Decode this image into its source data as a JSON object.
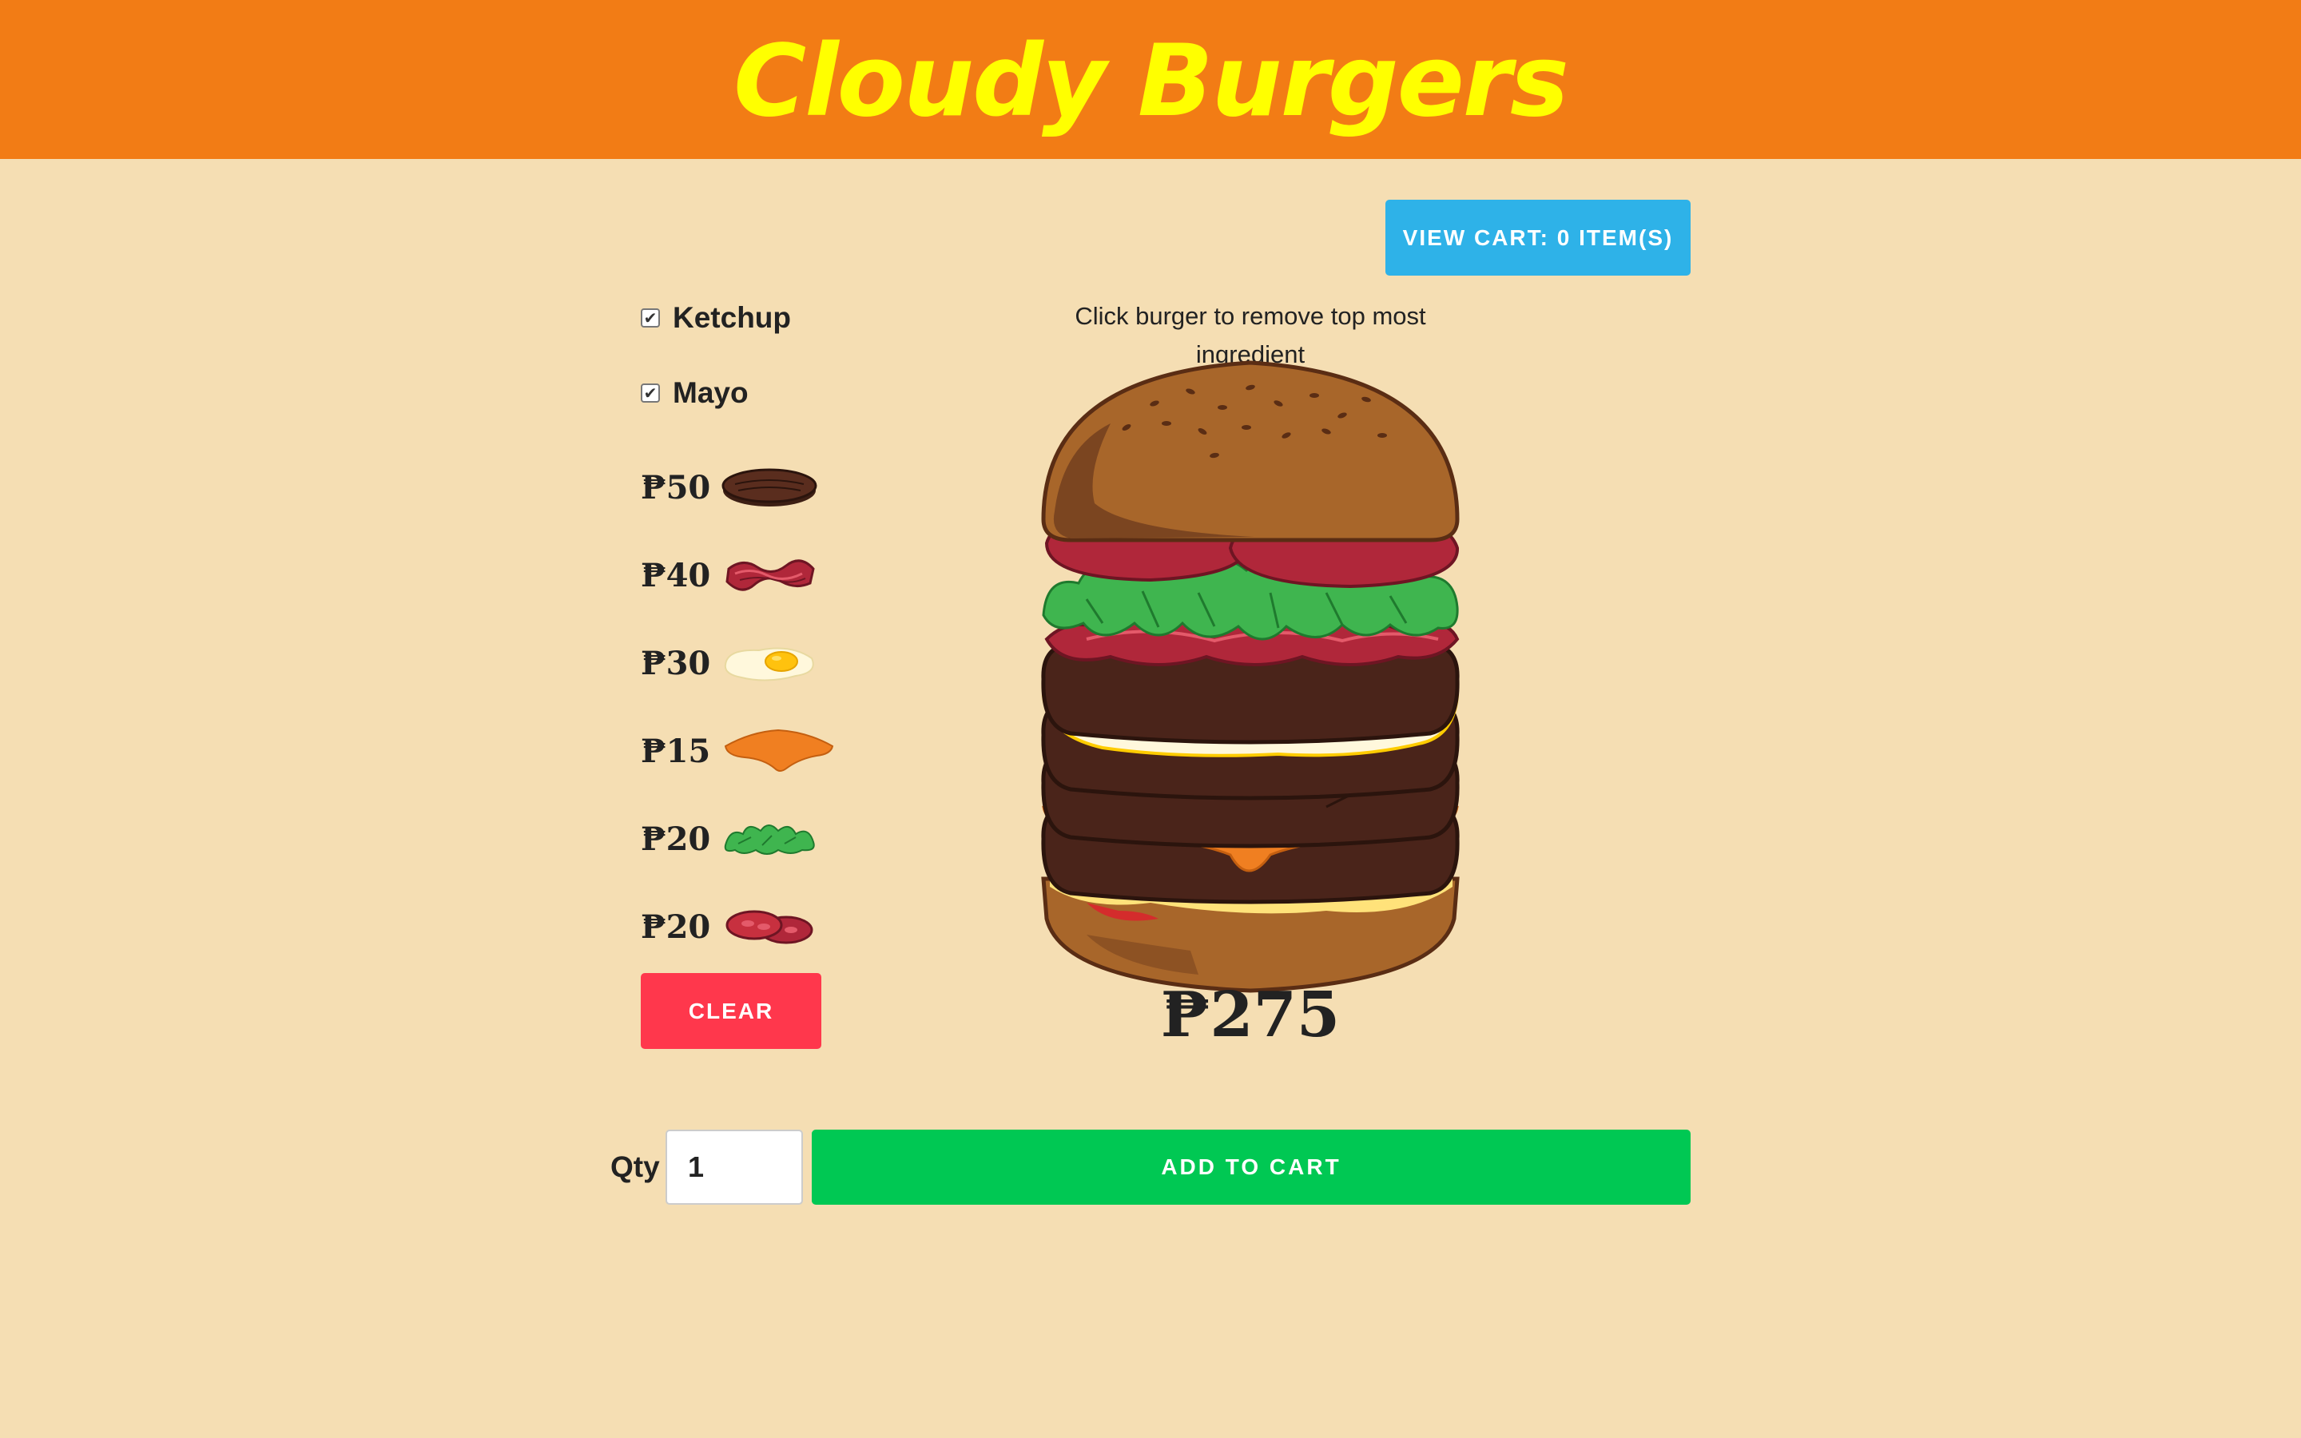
{
  "app": {
    "title": "Cloudy Burgers"
  },
  "colors": {
    "header_bg": "#f27c15",
    "title": "#ffff00",
    "page_bg": "#f5deb3",
    "cart_button": "#2eb2e8",
    "clear_button": "#ff374c",
    "add_button": "#00c853"
  },
  "cart": {
    "label": "VIEW CART: 0 ITEM(S)"
  },
  "condiments": [
    {
      "label": "Ketchup",
      "checked": true
    },
    {
      "label": "Mayo",
      "checked": true
    }
  ],
  "ingredients": [
    {
      "name": "patty-icon",
      "price": "₱50"
    },
    {
      "name": "bacon-icon",
      "price": "₱40"
    },
    {
      "name": "egg-icon",
      "price": "₱30"
    },
    {
      "name": "cheese-icon",
      "price": "₱15"
    },
    {
      "name": "lettuce-icon",
      "price": "₱20"
    },
    {
      "name": "tomato-icon",
      "price": "₱20"
    }
  ],
  "clear_label": "CLEAR",
  "hint": "Click burger to remove top most ingredient",
  "total": "₱275",
  "order": {
    "qty_label": "Qty",
    "qty_value": "1",
    "add_label": "ADD TO CART"
  }
}
